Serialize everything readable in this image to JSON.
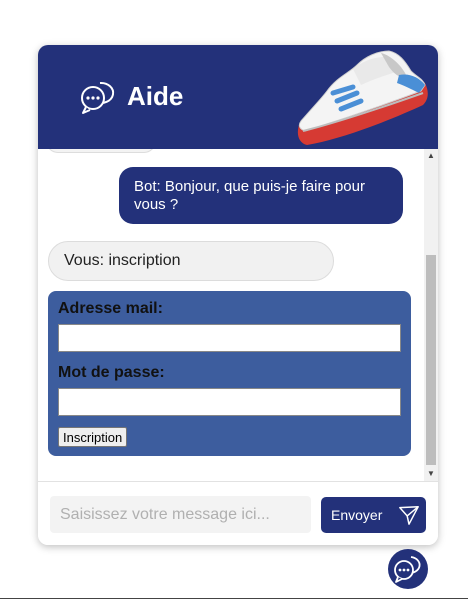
{
  "header": {
    "title": "Aide",
    "icon": "chat-bubbles-icon",
    "image": "sneaker-illustration"
  },
  "messages": {
    "bot_text": "Bot: Bonjour, que puis-je faire pour vous ?",
    "user_text": "Vous: inscription"
  },
  "form": {
    "email_label": "Adresse mail:",
    "password_label": "Mot de passe:",
    "submit_label": "Inscription"
  },
  "footer": {
    "input_placeholder": "Saisissez votre message ici...",
    "send_label": "Envoyer",
    "send_icon": "paper-plane-icon"
  },
  "launcher": {
    "icon": "chat-bubbles-icon"
  },
  "colors": {
    "primary": "#23317a",
    "form_bg": "#3d5d9e",
    "user_bubble": "#f1f1f1"
  }
}
